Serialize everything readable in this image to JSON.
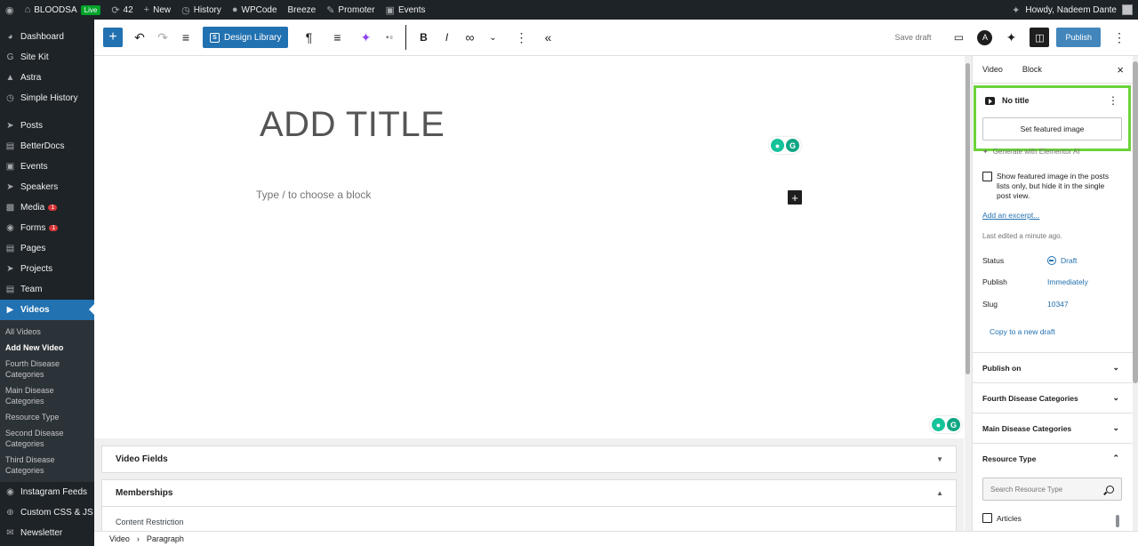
{
  "admin_bar": {
    "site_name": "BLOODSA",
    "live": "Live",
    "updates": "42",
    "new": "New",
    "history": "History",
    "wpcode": "WPCode",
    "breeze": "Breeze",
    "promoter": "Promoter",
    "events": "Events",
    "howdy": "Howdy, Nadeem Dante"
  },
  "sidebar": {
    "dashboard": "Dashboard",
    "site_kit": "Site Kit",
    "astra": "Astra",
    "simple_history": "Simple History",
    "posts": "Posts",
    "betterdocs": "BetterDocs",
    "events": "Events",
    "speakers": "Speakers",
    "media": "Media",
    "media_count": "1",
    "forms": "Forms",
    "forms_count": "1",
    "pages": "Pages",
    "projects": "Projects",
    "team": "Team",
    "videos": "Videos",
    "submenu": [
      "All Videos",
      "Add New Video",
      "Fourth Disease Categories",
      "Main Disease Categories",
      "Resource Type",
      "Second Disease Categories",
      "Third Disease Categories"
    ],
    "instagram": "Instagram Feeds",
    "custom_css": "Custom CSS & JS",
    "newsletter": "Newsletter"
  },
  "toolbar": {
    "design_library": "Design Library",
    "save_draft": "Save draft",
    "publish": "Publish"
  },
  "editor": {
    "title_placeholder": "ADD TITLE",
    "block_placeholder": "Type / to choose a block"
  },
  "metaboxes": {
    "video_fields": "Video Fields",
    "memberships": "Memberships",
    "content_restriction": "Content Restriction"
  },
  "breadcrumb": {
    "first": "Video",
    "second": "Paragraph"
  },
  "settings": {
    "tab_video": "Video",
    "tab_block": "Block",
    "post_title": "No title",
    "set_featured": "Set featured image",
    "generate_ai": "Generate with Elementor AI",
    "featured_checkbox": "Show featured image in the posts lists only, but hide it in the single post view.",
    "add_excerpt": "Add an excerpt...",
    "last_edited": "Last edited a minute ago.",
    "status_label": "Status",
    "status_value": "Draft",
    "publish_label": "Publish",
    "publish_value": "Immediately",
    "slug_label": "Slug",
    "slug_value": "10347",
    "copy_draft": "Copy to a new draft",
    "panels": [
      "Publish on",
      "Fourth Disease Categories",
      "Main Disease Categories",
      "Resource Type"
    ],
    "search_placeholder": "Search Resource Type",
    "term_articles": "Articles"
  },
  "colors": {
    "accent": "#2271b1",
    "highlight": "#6bd33a",
    "admin_dark": "#1d2327"
  }
}
